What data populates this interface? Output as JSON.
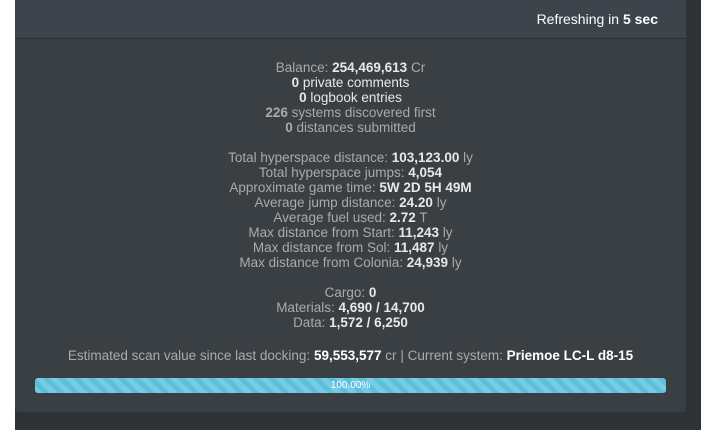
{
  "header": {
    "refresh_prefix": "Refreshing in",
    "refresh_value": "5 sec"
  },
  "stats": {
    "balance_label": "Balance:",
    "balance_value": "254,469,613",
    "balance_unit": "Cr",
    "private_comments_value": "0",
    "private_comments_label": "private comments",
    "logbook_value": "0",
    "logbook_label": "logbook entries",
    "discovered_value": "226",
    "discovered_label": "systems discovered first",
    "distances_value": "0",
    "distances_label": "distances submitted",
    "hyperspace_distance_label": "Total hyperspace distance:",
    "hyperspace_distance_value": "103,123.00",
    "hyperspace_distance_unit": "ly",
    "hyperspace_jumps_label": "Total hyperspace jumps:",
    "hyperspace_jumps_value": "4,054",
    "game_time_label": "Approximate game time:",
    "game_time_value": "5W 2D 5H 49M",
    "avg_jump_label": "Average jump distance:",
    "avg_jump_value": "24.20",
    "avg_jump_unit": "ly",
    "avg_fuel_label": "Average fuel used:",
    "avg_fuel_value": "2.72",
    "avg_fuel_unit": "T",
    "max_start_label": "Max distance from Start:",
    "max_start_value": "11,243",
    "max_start_unit": "ly",
    "max_sol_label": "Max distance from Sol:",
    "max_sol_value": "11,487",
    "max_sol_unit": "ly",
    "max_colonia_label": "Max distance from Colonia:",
    "max_colonia_value": "24,939",
    "max_colonia_unit": "ly",
    "cargo_label": "Cargo:",
    "cargo_value": "0",
    "materials_label": "Materials:",
    "materials_value": "4,690 / 14,700",
    "data_label": "Data:",
    "data_value": "1,572 / 6,250"
  },
  "scan": {
    "label": "Estimated scan value since last docking:",
    "value": "59,553,577",
    "unit": "cr",
    "separator": "|",
    "system_label": "Current system:",
    "system_value": "Priemoe LC-L d8-15"
  },
  "progress": {
    "percent": 100,
    "text": "100.00%",
    "color": "#5bc0de"
  }
}
